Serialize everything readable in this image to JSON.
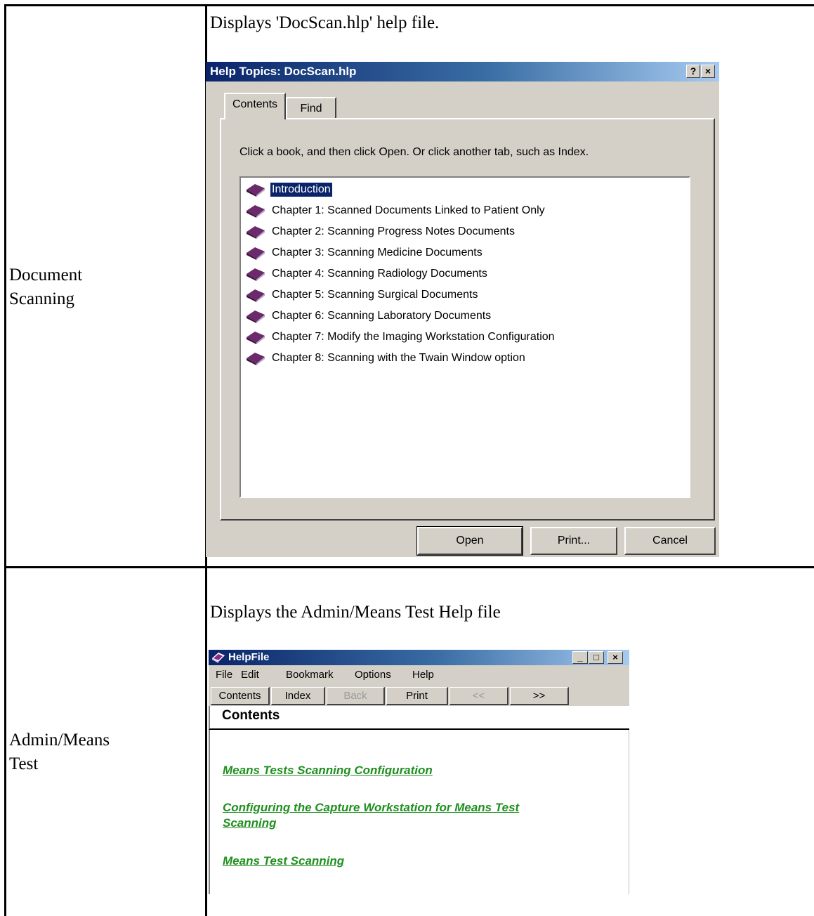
{
  "rows": [
    {
      "label": " Document\nScanning",
      "description": "Displays 'DocScan.hlp' help file."
    },
    {
      "label": "Admin/Means\nTest",
      "description": "Displays the Admin/Means Test Help file"
    }
  ],
  "help_topics": {
    "title": "Help Topics: DocScan.hlp",
    "help_button": "?",
    "close_button": "×",
    "tabs": [
      "Contents",
      "Find"
    ],
    "instruction": "Click a book, and then click Open. Or click another tab, such as Index.",
    "selected_index": 0,
    "items": [
      "Introduction",
      "Chapter 1: Scanned Documents Linked to Patient Only",
      "Chapter 2: Scanning Progress Notes Documents",
      "Chapter 3: Scanning Medicine Documents",
      "Chapter 4: Scanning Radiology Documents",
      "Chapter 5: Scanning Surgical Documents",
      "Chapter 6: Scanning Laboratory Documents",
      "Chapter 7: Modify the Imaging Workstation Configuration",
      "Chapter 8: Scanning with the Twain Window option"
    ],
    "buttons": {
      "open": "Open",
      "print": "Print...",
      "cancel": "Cancel"
    },
    "colors": {
      "title_bar": "#0a246a",
      "selection": "#0a246a",
      "book_icon": "#6b2a6b",
      "face": "#d4d0c8"
    }
  },
  "helpfile": {
    "title": "HelpFile",
    "window_buttons": {
      "minimize": "_",
      "maximize": "□",
      "close": "×"
    },
    "menu": [
      "File",
      "Edit",
      "Bookmark",
      "Options",
      "Help"
    ],
    "toolbar": [
      "Contents",
      "Index",
      "Back",
      "Print",
      "<<",
      ">>"
    ],
    "heading": "Contents",
    "links": [
      "Means Tests Scanning Configuration",
      "Configuring the Capture Workstation for Means Test\nScanning",
      "Means Test Scanning"
    ],
    "colors": {
      "link": "#1f8f1f"
    }
  }
}
